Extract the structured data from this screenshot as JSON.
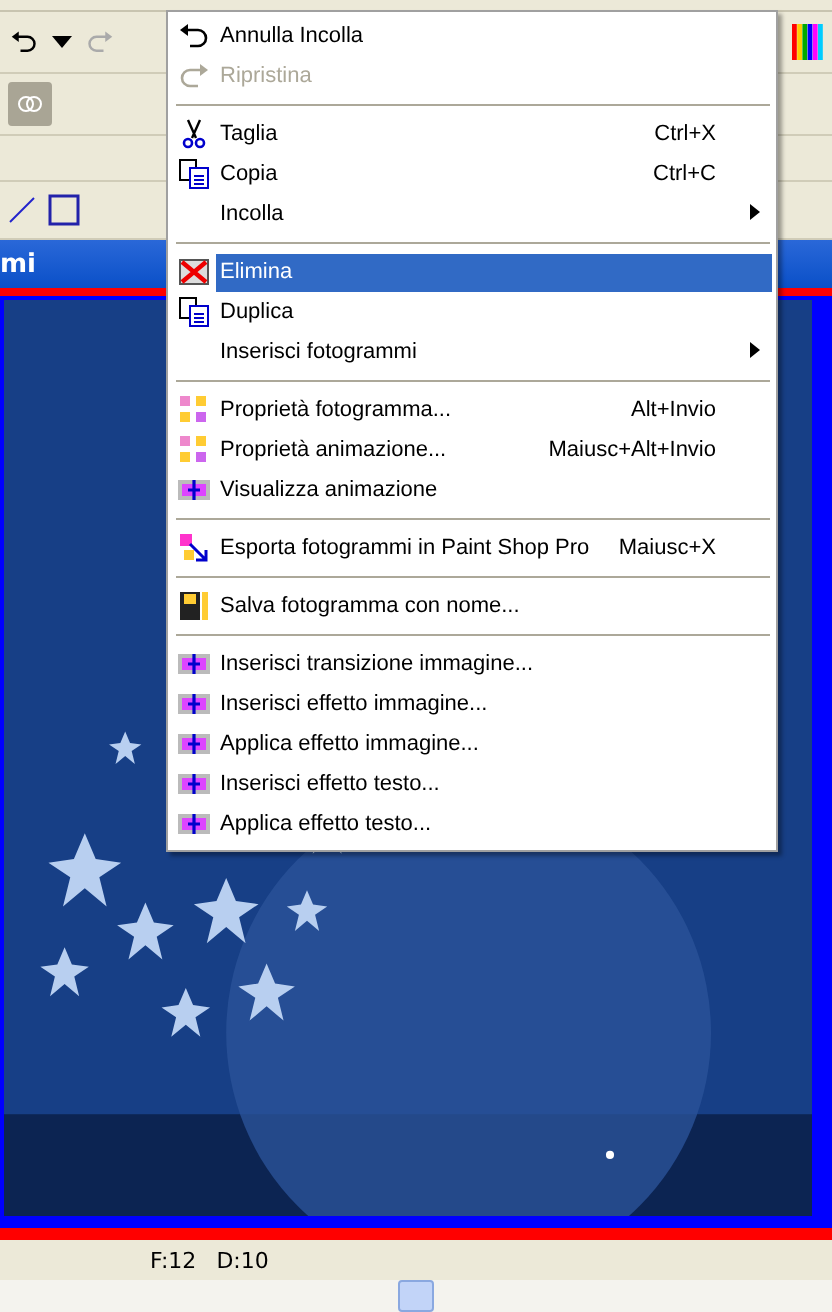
{
  "document_window": {
    "title": "mi"
  },
  "status_bar": {
    "frame": "F:12",
    "delay": "D:10"
  },
  "context_menu": {
    "items": [
      {
        "kind": "item",
        "label": "Annulla Incolla",
        "disabled": false,
        "selected": false
      },
      {
        "kind": "item",
        "label": "Ripristina",
        "disabled": true,
        "selected": false
      },
      {
        "kind": "separator"
      },
      {
        "kind": "item",
        "label": "Taglia",
        "shortcut": "Ctrl+X",
        "disabled": false,
        "selected": false
      },
      {
        "kind": "item",
        "label": "Copia",
        "shortcut": "Ctrl+C",
        "disabled": false,
        "selected": false
      },
      {
        "kind": "item",
        "label": "Incolla",
        "submenu": true,
        "disabled": false,
        "selected": false
      },
      {
        "kind": "separator"
      },
      {
        "kind": "item",
        "label": "Elimina",
        "disabled": false,
        "selected": true
      },
      {
        "kind": "item",
        "label": "Duplica",
        "disabled": false,
        "selected": false
      },
      {
        "kind": "item",
        "label": "Inserisci fotogrammi",
        "submenu": true,
        "disabled": false,
        "selected": false
      },
      {
        "kind": "separator"
      },
      {
        "kind": "item",
        "label": "Proprietà fotogramma...",
        "shortcut": "Alt+Invio",
        "disabled": false,
        "selected": false
      },
      {
        "kind": "item",
        "label": "Proprietà animazione...",
        "shortcut": "Maiusc+Alt+Invio",
        "disabled": false,
        "selected": false
      },
      {
        "kind": "item",
        "label": "Visualizza animazione",
        "disabled": false,
        "selected": false
      },
      {
        "kind": "separator"
      },
      {
        "kind": "item",
        "label": "Esporta fotogrammi in Paint Shop Pro",
        "shortcut": "Maiusc+X",
        "disabled": false,
        "selected": false
      },
      {
        "kind": "separator"
      },
      {
        "kind": "item",
        "label": "Salva fotogramma con nome...",
        "disabled": false,
        "selected": false
      },
      {
        "kind": "separator"
      },
      {
        "kind": "item",
        "label": "Inserisci transizione immagine...",
        "disabled": false,
        "selected": false
      },
      {
        "kind": "item",
        "label": "Inserisci effetto immagine...",
        "disabled": false,
        "selected": false
      },
      {
        "kind": "item",
        "label": "Applica effetto immagine...",
        "disabled": false,
        "selected": false
      },
      {
        "kind": "item",
        "label": "Inserisci effetto testo...",
        "disabled": false,
        "selected": false
      },
      {
        "kind": "item",
        "label": "Applica effetto testo...",
        "disabled": false,
        "selected": false
      }
    ]
  }
}
